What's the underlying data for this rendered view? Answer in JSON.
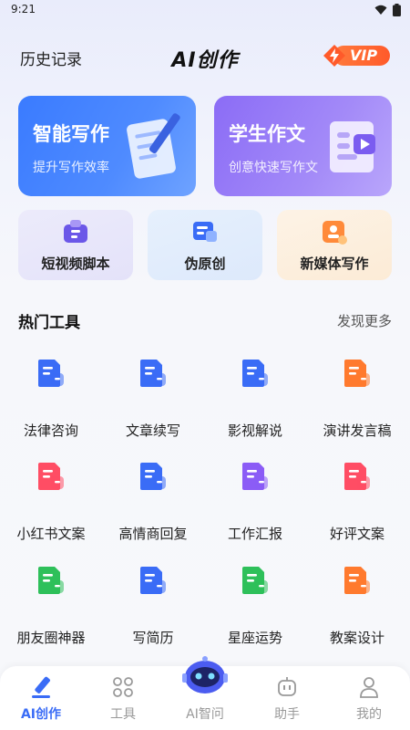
{
  "status": {
    "time": "9:21"
  },
  "header": {
    "history": "历史记录",
    "title": "AI创作",
    "vip": "VIP"
  },
  "features": [
    {
      "title": "智能写作",
      "subtitle": "提升写作效率"
    },
    {
      "title": "学生作文",
      "subtitle": "创意快速写作文"
    }
  ],
  "quick": [
    {
      "label": "短视频脚本",
      "icon": "video-script-icon"
    },
    {
      "label": "伪原创",
      "icon": "rewrite-icon"
    },
    {
      "label": "新媒体写作",
      "icon": "new-media-icon"
    }
  ],
  "hot": {
    "title": "热门工具",
    "more": "发现更多"
  },
  "tools": [
    {
      "label": "法律咨询",
      "icon": "law-doc-icon",
      "color": "#3a6cf6"
    },
    {
      "label": "文章续写",
      "icon": "article-pen-icon",
      "color": "#3a6cf6"
    },
    {
      "label": "影视解说",
      "icon": "film-headphone-icon",
      "color": "#3a6cf6"
    },
    {
      "label": "演讲发言稿",
      "icon": "speech-doc-icon",
      "color": "#ff7a2e"
    },
    {
      "label": "小红书文案",
      "icon": "xiaohongshu-doc-icon",
      "color": "#ff4d64"
    },
    {
      "label": "高情商回复",
      "icon": "eq-reply-icon",
      "color": "#3a6cf6"
    },
    {
      "label": "工作汇报",
      "icon": "work-report-icon",
      "color": "#8b5cf6"
    },
    {
      "label": "好评文案",
      "icon": "good-review-icon",
      "color": "#ff4d64"
    },
    {
      "label": "朋友圈神器",
      "icon": "moments-icon",
      "color": "#2ec05a"
    },
    {
      "label": "写简历",
      "icon": "resume-icon",
      "color": "#3a6cf6"
    },
    {
      "label": "星座运势",
      "icon": "star-icon",
      "color": "#2ec05a"
    },
    {
      "label": "教案设计",
      "icon": "lesson-plan-icon",
      "color": "#ff7a2e"
    }
  ],
  "tabs": [
    {
      "label": "AI创作",
      "icon": "pen-icon",
      "active": true
    },
    {
      "label": "工具",
      "icon": "grid-icon",
      "active": false
    },
    {
      "label": "AI智问",
      "icon": "robot-icon",
      "active": false
    },
    {
      "label": "助手",
      "icon": "assistant-icon",
      "active": false
    },
    {
      "label": "我的",
      "icon": "profile-icon",
      "active": false
    }
  ],
  "colors": {
    "primary": "#3a6cf6",
    "vip": "#ff5a2a",
    "purple": "#8b6cf6"
  }
}
